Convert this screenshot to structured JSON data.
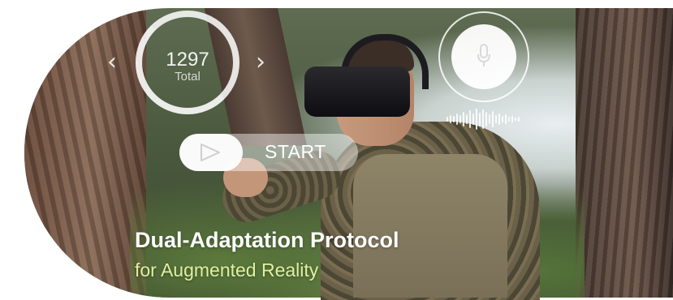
{
  "counter": {
    "value": "1297",
    "label": "Total"
  },
  "nav": {
    "prev_glyph": "‹",
    "next_glyph": "›"
  },
  "voice": {
    "icon": "microphone-icon",
    "waveform_icon": "audio-waveform-icon"
  },
  "start_control": {
    "label": "START",
    "icon": "play-icon"
  },
  "headline": {
    "title": "Dual-Adaptation Protocol",
    "subtitle": "for Augmented Reality"
  },
  "colors": {
    "subtitle": "#dff0a0",
    "overlay": "#ffffff"
  }
}
